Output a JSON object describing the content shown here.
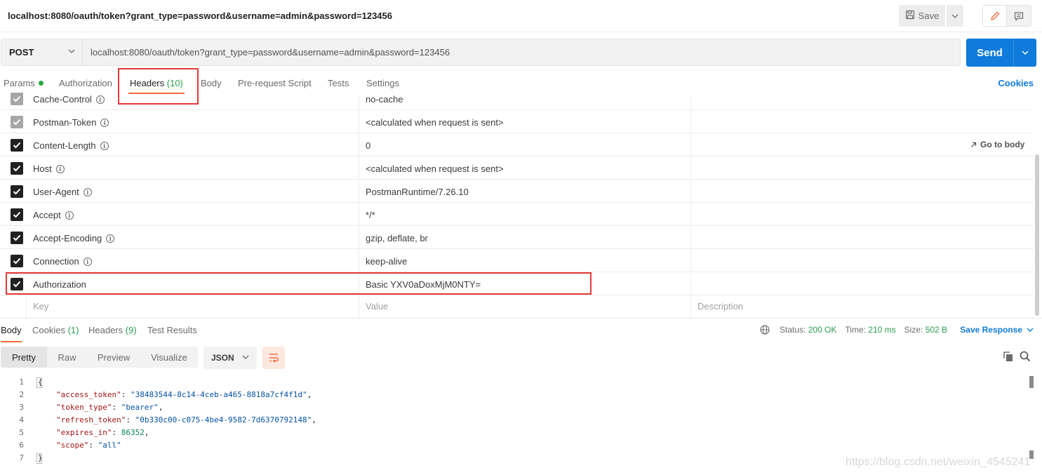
{
  "window": {
    "title": "localhost:8080/oauth/token?grant_type=password&username=admin&password=123456",
    "save_label": "Save"
  },
  "request": {
    "method": "POST",
    "url": "localhost:8080/oauth/token?grant_type=password&username=admin&password=123456",
    "send_label": "Send"
  },
  "req_tabs": {
    "params": "Params",
    "authorization": "Authorization",
    "headers": "Headers",
    "headers_count": "(10)",
    "body": "Body",
    "prerequest": "Pre-request Script",
    "tests": "Tests",
    "settings": "Settings",
    "cookies": "Cookies"
  },
  "headers": {
    "rows": [
      {
        "key": "Cache-Control",
        "value": "no-cache"
      },
      {
        "key": "Postman-Token",
        "value": "<calculated when request is sent>"
      },
      {
        "key": "Content-Length",
        "value": "0"
      },
      {
        "key": "Host",
        "value": "<calculated when request is sent>"
      },
      {
        "key": "User-Agent",
        "value": "PostmanRuntime/7.26.10"
      },
      {
        "key": "Accept",
        "value": "*/*"
      },
      {
        "key": "Accept-Encoding",
        "value": "gzip, deflate, br"
      },
      {
        "key": "Connection",
        "value": "keep-alive"
      },
      {
        "key": "Authorization",
        "value": "Basic YXV0aDoxMjM0NTY="
      }
    ],
    "go_to_body": "Go to body",
    "placeholder_key": "Key",
    "placeholder_value": "Value",
    "placeholder_description": "Description"
  },
  "response_tabs": {
    "body": "Body",
    "cookies": "Cookies",
    "cookies_count": "(1)",
    "headers": "Headers",
    "headers_count": "(9)",
    "test_results": "Test Results"
  },
  "status": {
    "status_label": "Status:",
    "status_value": "200 OK",
    "time_label": "Time:",
    "time_value": "210 ms",
    "size_label": "Size:",
    "size_value": "502 B",
    "save_response": "Save Response"
  },
  "view": {
    "pretty": "Pretty",
    "raw": "Raw",
    "preview": "Preview",
    "visualize": "Visualize",
    "format": "JSON"
  },
  "code": {
    "lines": [
      "1",
      "2",
      "3",
      "4",
      "5",
      "6",
      "7"
    ],
    "open": "{",
    "close": "}",
    "access_token_key": "\"access_token\"",
    "access_token_val": "\"38483544-8c14-4ceb-a465-8818a7cf4f1d\"",
    "token_type_key": "\"token_type\"",
    "token_type_val": "\"bearer\"",
    "refresh_token_key": "\"refresh_token\"",
    "refresh_token_val": "\"0b330c00-c075-4be4-9582-7d6370792148\"",
    "expires_in_key": "\"expires_in\"",
    "expires_in_val": "86352",
    "scope_key": "\"scope\"",
    "scope_val": "\"all\""
  },
  "watermark": "https://blog.csdn.net/weixin_4545241"
}
